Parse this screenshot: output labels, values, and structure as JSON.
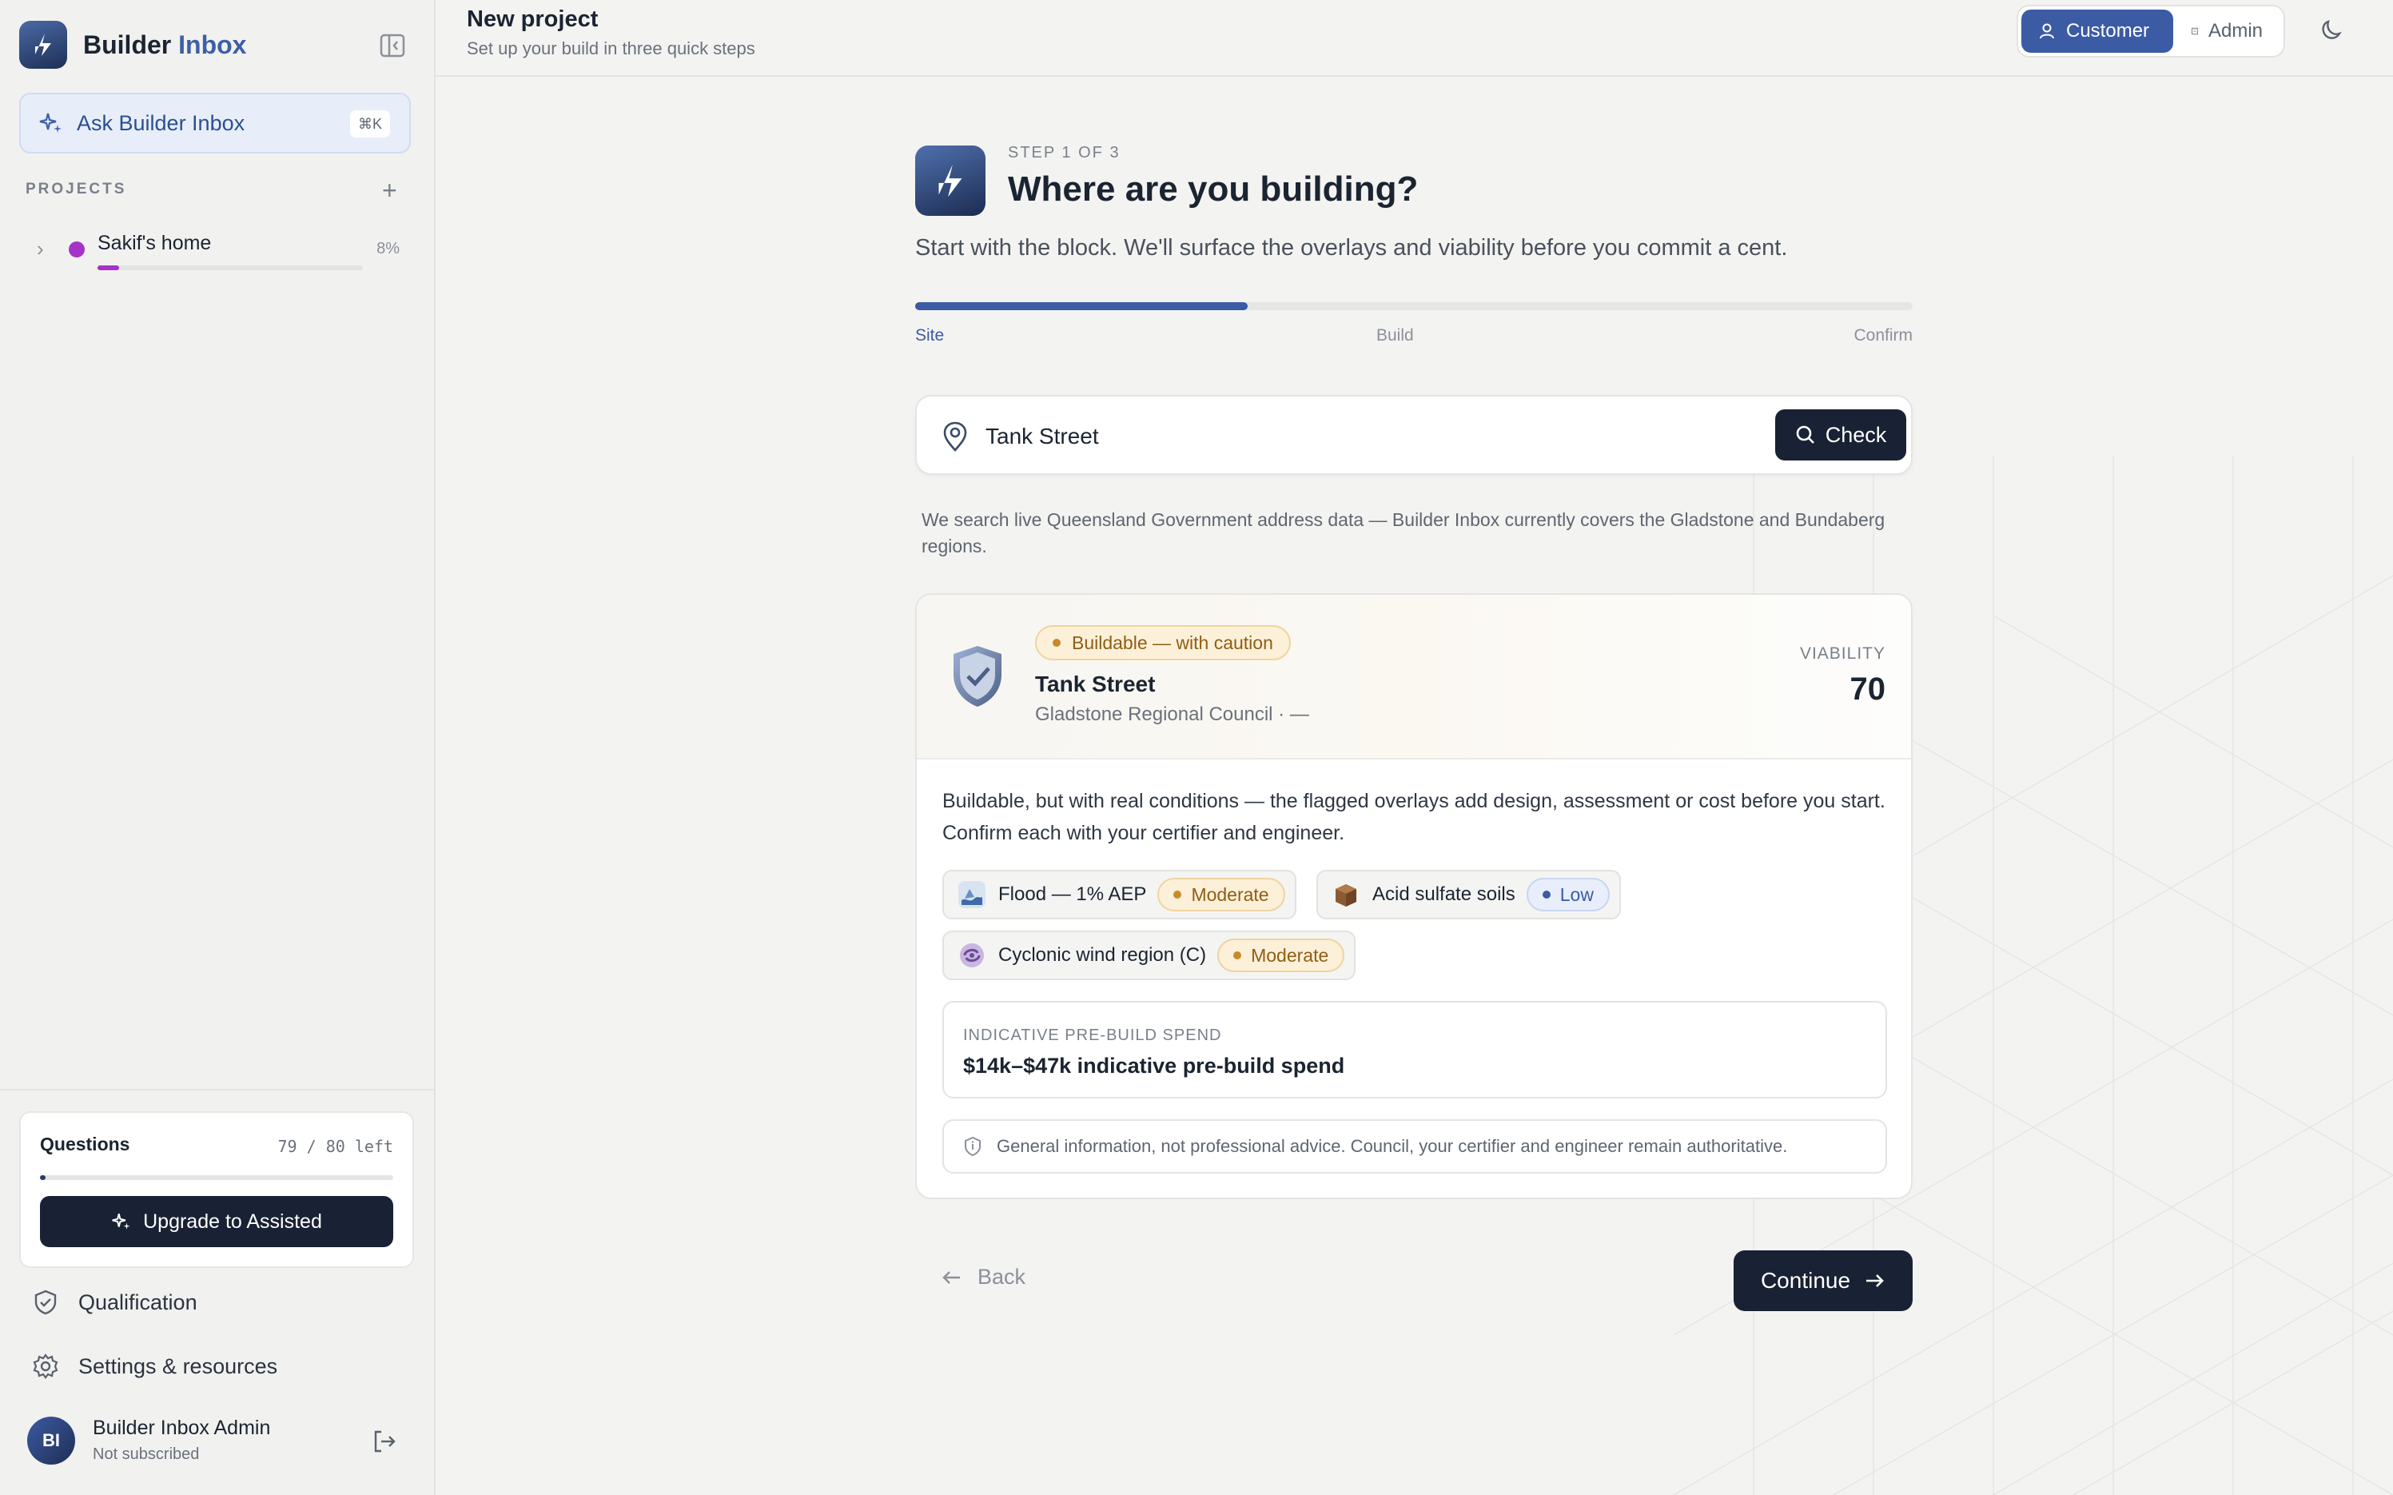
{
  "sidebar": {
    "brand_word1": "Builder",
    "brand_word2": "Inbox",
    "ask_label": "Ask Builder Inbox",
    "ask_shortcut": "⌘K",
    "projects_heading": "PROJECTS",
    "projects": [
      {
        "name": "Sakif's home",
        "progress_label": "8%",
        "progress": 0.08,
        "color": "#a633c8"
      }
    ],
    "questions": {
      "title": "Questions",
      "count_label": "79 / 80 left",
      "used_fraction": 0.0125,
      "upgrade_label": "Upgrade to Assisted"
    },
    "nav": [
      {
        "label": "Qualification",
        "icon": "shield-check-icon"
      },
      {
        "label": "Settings & resources",
        "icon": "gear-icon"
      }
    ],
    "user": {
      "initials": "BI",
      "name": "Builder Inbox Admin",
      "status": "Not subscribed"
    }
  },
  "header": {
    "title": "New project",
    "subtitle": "Set up your build in three quick steps",
    "roles": [
      "Customer",
      "Admin"
    ],
    "active_role": "Customer"
  },
  "wizard": {
    "step_label": "STEP 1 OF 3",
    "title": "Where are you building?",
    "lead": "Start with the block. We'll surface the overlays and viability before you commit a cent.",
    "progress_fraction": 0.333,
    "steps": [
      "Site",
      "Build",
      "Confirm"
    ],
    "active_step": "Site",
    "search": {
      "value": "Tank Street",
      "placeholder": "",
      "button_label": "Check"
    },
    "note": "We search live Queensland Government address data — Builder Inbox currently covers the Gladstone and Bundaberg regions.",
    "result": {
      "badge": "Buildable — with caution",
      "site_name": "Tank Street",
      "site_sub": "Gladstone Regional Council · —",
      "viability_label": "VIABILITY",
      "viability_value": "70",
      "description": "Buildable, but with real conditions — the flagged overlays add design, assessment or cost before you start. Confirm each with your certifier and engineer.",
      "overlays": [
        {
          "label": "Flood — 1% AEP",
          "level": "Moderate",
          "icon": "flood-icon"
        },
        {
          "label": "Acid sulfate soils",
          "level": "Low",
          "icon": "soil-icon"
        },
        {
          "label": "Cyclonic wind region (C)",
          "level": "Moderate",
          "icon": "cyclone-icon"
        }
      ],
      "spend_label": "INDICATIVE PRE-BUILD SPEND",
      "spend_value": "$14k–$47k indicative pre-build spend",
      "disclaimer": "General information, not professional advice. Council, your certifier and engineer remain authoritative."
    },
    "back_label": "Back",
    "continue_label": "Continue"
  },
  "colors": {
    "accent": "#3b5ba5",
    "dark": "#192234",
    "caution": "#c98a2a",
    "project": "#a633c8"
  }
}
